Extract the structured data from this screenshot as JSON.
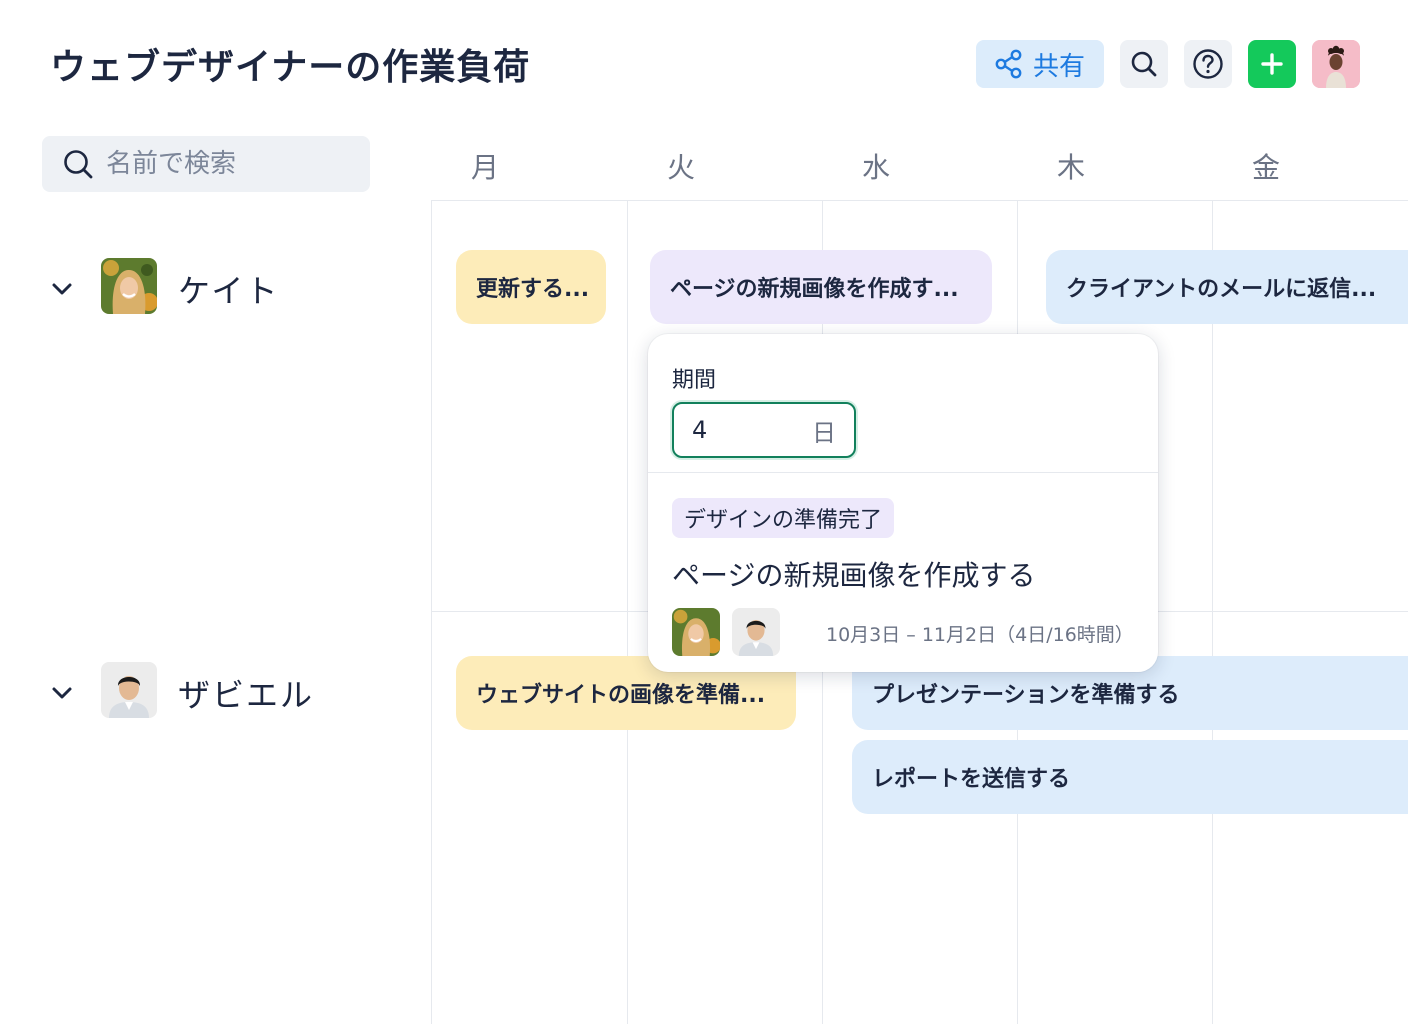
{
  "header": {
    "title": "ウェブデザイナーの作業負荷",
    "share_label": "共有",
    "icons": [
      "share-icon",
      "search-icon",
      "help-icon",
      "plus-icon",
      "user-avatar"
    ]
  },
  "search": {
    "placeholder": "名前で検索"
  },
  "days": [
    "月",
    "火",
    "水",
    "木",
    "金"
  ],
  "people": [
    {
      "name": "ケイト",
      "tasks": [
        "更新する...",
        "ページの新規画像を作成す...",
        "クライアントのメールに返信..."
      ]
    },
    {
      "name": "ザビエル",
      "tasks": [
        "ウェブサイトの画像を準備...",
        "プレゼンテーションを準備する",
        "レポートを送信する"
      ]
    }
  ],
  "popover": {
    "duration_label": "期間",
    "duration_value": "4",
    "duration_unit": "日",
    "status": "デザインの準備完了",
    "task_name": "ページの新規画像を作成する",
    "dates": "10月3日 – 11月2日（4日/16時間）"
  },
  "colors": {
    "accent_green": "#14c95b",
    "share_blue": "#1d7ae0",
    "task_yellow": "#fdecb9",
    "task_purple": "#ede8fb",
    "task_blue": "#ddecfb",
    "focus_green": "#12805c"
  }
}
